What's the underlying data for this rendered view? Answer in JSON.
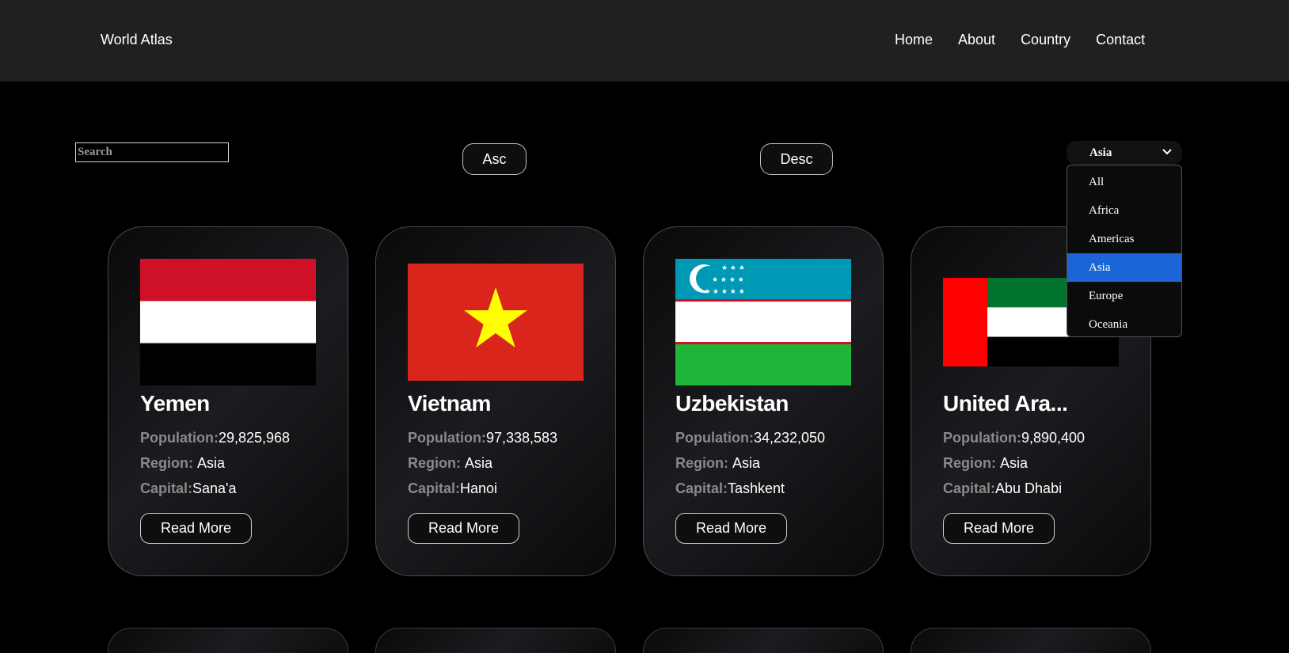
{
  "header": {
    "logo": "World Atlas",
    "nav": [
      "Home",
      "About",
      "Country",
      "Contact"
    ]
  },
  "controls": {
    "search_placeholder": "Search",
    "asc_label": "Asc",
    "desc_label": "Desc",
    "region_selected": "Asia",
    "region_options": [
      "All",
      "Africa",
      "Americas",
      "Asia",
      "Europe",
      "Oceania"
    ]
  },
  "labels": {
    "population": "Population:",
    "region": "Region: ",
    "capital": "Capital:",
    "read_more": "Read More"
  },
  "countries": [
    {
      "name": "Yemen",
      "population": "29,825,968",
      "region": "Asia",
      "capital": "Sana'a",
      "flag": "yemen-flag"
    },
    {
      "name": "Vietnam",
      "population": "97,338,583",
      "region": "Asia",
      "capital": "Hanoi",
      "flag": "vietnam-flag"
    },
    {
      "name": "Uzbekistan",
      "population": "34,232,050",
      "region": "Asia",
      "capital": "Tashkent",
      "flag": "uzbekistan-flag"
    },
    {
      "name": "United Ara...",
      "population": "9,890,400",
      "region": "Asia",
      "capital": "Abu Dhabi",
      "flag": "uae-flag"
    }
  ],
  "colors": {
    "background": "#000000",
    "header": "#202020",
    "selected_option": "#1a66d6",
    "label_gray": "#8a8a8a"
  }
}
